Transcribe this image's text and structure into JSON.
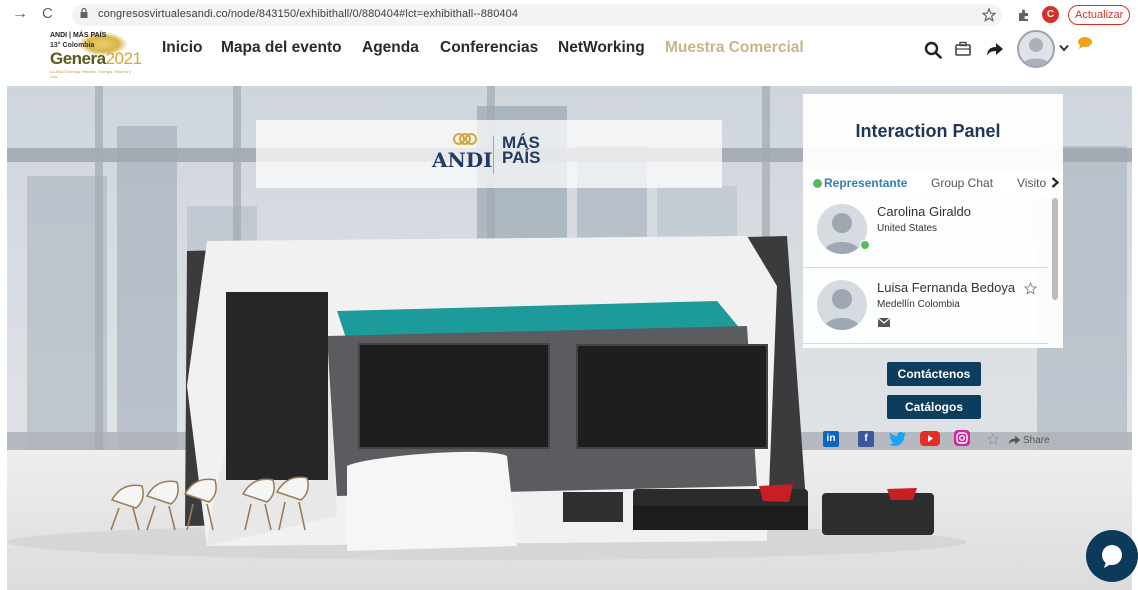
{
  "browser": {
    "url": "congresosvirtualesandi.co/node/843150/exhibithall/0/880404#lct=exhibithall--880404",
    "profile_initial": "C",
    "update_label": "Actualizar"
  },
  "logo": {
    "line1": "ANDI | MÁS PAÍS",
    "line2": "13° Colombia",
    "word": "Genera",
    "year": "2021",
    "tagline": "La ANDI Energía Petróleo, Energía, Minería y Gas"
  },
  "nav": {
    "items": [
      {
        "label": "Inicio"
      },
      {
        "label": "Mapa del evento"
      },
      {
        "label": "Agenda"
      },
      {
        "label": "Conferencias"
      },
      {
        "label": "NetWorking"
      },
      {
        "label": "Muestra Comercial"
      }
    ],
    "active_color": "#c9b48a"
  },
  "booth": {
    "banner_andi": "ANDI",
    "banner_mas": "MÁS",
    "banner_pais": "PAÍS"
  },
  "panel": {
    "title": "Interaction Panel",
    "tabs": [
      {
        "label": "Representante"
      },
      {
        "label": "Group Chat"
      },
      {
        "label": "Visito"
      }
    ],
    "representatives": [
      {
        "name": "Carolina Giraldo",
        "location": "United States",
        "online": true
      },
      {
        "name": "Luisa Fernanda Bedoya",
        "location": "Medellín Colombia",
        "online": false
      }
    ],
    "buttons": {
      "contact": "Contáctenos",
      "catalog": "Catálogos"
    },
    "share_label": "Share"
  },
  "colors": {
    "brand_navy": "#0c3d5c",
    "title_navy": "#1f3655",
    "tab_active": "#2f7fb8",
    "online_green": "#5cb85c",
    "teal_accent": "#1d9b9b"
  }
}
